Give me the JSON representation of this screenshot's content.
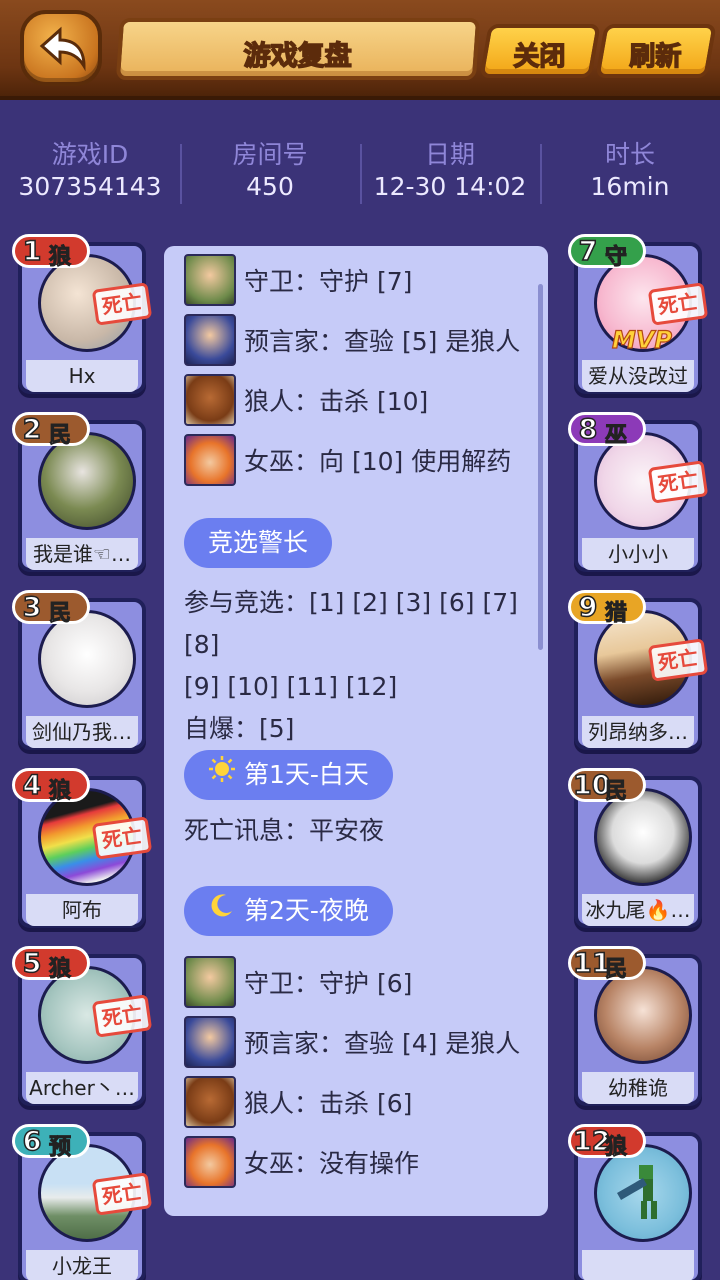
{
  "header": {
    "title": "游戏复盘",
    "close_label": "关闭",
    "refresh_label": "刷新"
  },
  "info": [
    {
      "label": "游戏ID",
      "value": "307354143"
    },
    {
      "label": "房间号",
      "value": "450"
    },
    {
      "label": "日期",
      "value": "12-30 14:02"
    },
    {
      "label": "时长",
      "value": "16min"
    }
  ],
  "players_left": [
    {
      "num": "1",
      "role": "狼",
      "name": "Hx",
      "dead": true
    },
    {
      "num": "2",
      "role": "民",
      "name": "我是谁☜…",
      "dead": false
    },
    {
      "num": "3",
      "role": "民",
      "name": "剑仙乃我…",
      "dead": false
    },
    {
      "num": "4",
      "role": "狼",
      "name": "阿布",
      "dead": true
    },
    {
      "num": "5",
      "role": "狼",
      "name": "Archer丶…",
      "dead": true
    },
    {
      "num": "6",
      "role": "预",
      "name": "小龙王",
      "dead": true
    }
  ],
  "players_right": [
    {
      "num": "7",
      "role": "守",
      "name": "爱从没改过",
      "dead": true,
      "mvp": "MVP"
    },
    {
      "num": "8",
      "role": "巫",
      "name": "小小小",
      "dead": true
    },
    {
      "num": "9",
      "role": "猎",
      "name": "列昂纳多…",
      "dead": true
    },
    {
      "num": "10",
      "role": "民",
      "name": "冰九尾🔥…",
      "dead": false
    },
    {
      "num": "11",
      "role": "民",
      "name": "幼稚诡",
      "dead": false
    },
    {
      "num": "12",
      "role": "狼",
      "name": "",
      "dead": false
    }
  ],
  "dead_label": "死亡",
  "log": {
    "night1": [
      {
        "icon": "guard-icon",
        "text": "守卫：守护 [7]"
      },
      {
        "icon": "seer-icon",
        "text": "预言家：查验 [5] 是狼人"
      },
      {
        "icon": "werewolf-icon",
        "text": "狼人：击杀 [10]"
      },
      {
        "icon": "witch-icon",
        "text": "女巫：向 [10] 使用解药"
      }
    ],
    "sheriff": {
      "title": "竞选警长",
      "candidates_line1": "参与竞选：[1] [2] [3] [6] [7] [8]",
      "candidates_line2": "[9] [10] [11] [12]",
      "self_explode": "自爆：[5]"
    },
    "day1": {
      "title": "第1天-白天",
      "death_info": "死亡讯息：平安夜"
    },
    "night2": {
      "title": "第2天-夜晚",
      "actions": [
        {
          "icon": "guard-icon",
          "text": "守卫：守护 [6]"
        },
        {
          "icon": "seer-icon",
          "text": "预言家：查验 [4] 是狼人"
        },
        {
          "icon": "werewolf-icon",
          "text": "狼人：击杀 [6]"
        },
        {
          "icon": "witch-icon",
          "text": "女巫：没有操作"
        }
      ]
    }
  },
  "colors": {
    "background": "#3b3378",
    "panel": "#c6cbf8",
    "pill": "#6b7ef0",
    "dead_stamp": "#e64a3c"
  }
}
